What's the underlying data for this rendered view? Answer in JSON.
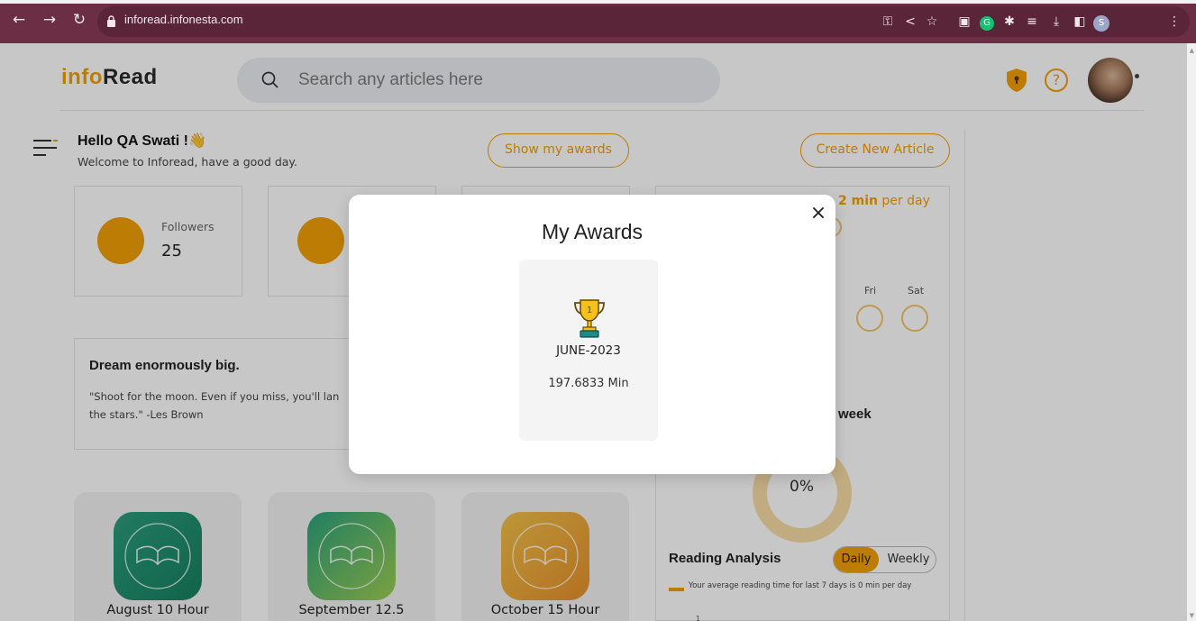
{
  "browser": {
    "url": "inforead.infonesta.com",
    "profile_initial": "S",
    "grammarly_letter": "G"
  },
  "header": {
    "logo_prefix": "info",
    "logo_suffix": "Read",
    "search_placeholder": "Search any articles here",
    "help_symbol": "?"
  },
  "greeting": {
    "title": "Hello QA Swati !",
    "emoji": "👋",
    "subtitle": "Welcome to Inforead, have a good day."
  },
  "buttons": {
    "show_awards": "Show my awards",
    "create_article": "Create New Article"
  },
  "stats": {
    "followers_label": "Followers",
    "followers_value": "25"
  },
  "quote": {
    "title": "Dream enormously big.",
    "text": "\"Shoot for the moon. Even if you miss, you'll lan the stars.\" -Les Brown"
  },
  "reading_goal": {
    "value": "2 min",
    "suffix": " per day"
  },
  "week_days": [
    "Fri",
    "Sat"
  ],
  "week_card": {
    "title": "week",
    "percent": "0%"
  },
  "reading_analysis": {
    "title": "Reading Analysis",
    "toggle_daily": "Daily",
    "toggle_weekly": "Weekly",
    "legend": "Your average reading time for last 7 days is 0 min per day",
    "axis_tick": "1"
  },
  "monthly_badges": [
    {
      "label": "August 10 Hour"
    },
    {
      "label": "September 12.5"
    },
    {
      "label": "October 15 Hour"
    }
  ],
  "modal": {
    "title": "My Awards",
    "close_symbol": "×",
    "award": {
      "month": "JUNE-2023",
      "minutes": "197.6833 Min",
      "rank": "1"
    }
  },
  "colors": {
    "accent": "#f29f05",
    "chrome": "#6b2e45"
  }
}
